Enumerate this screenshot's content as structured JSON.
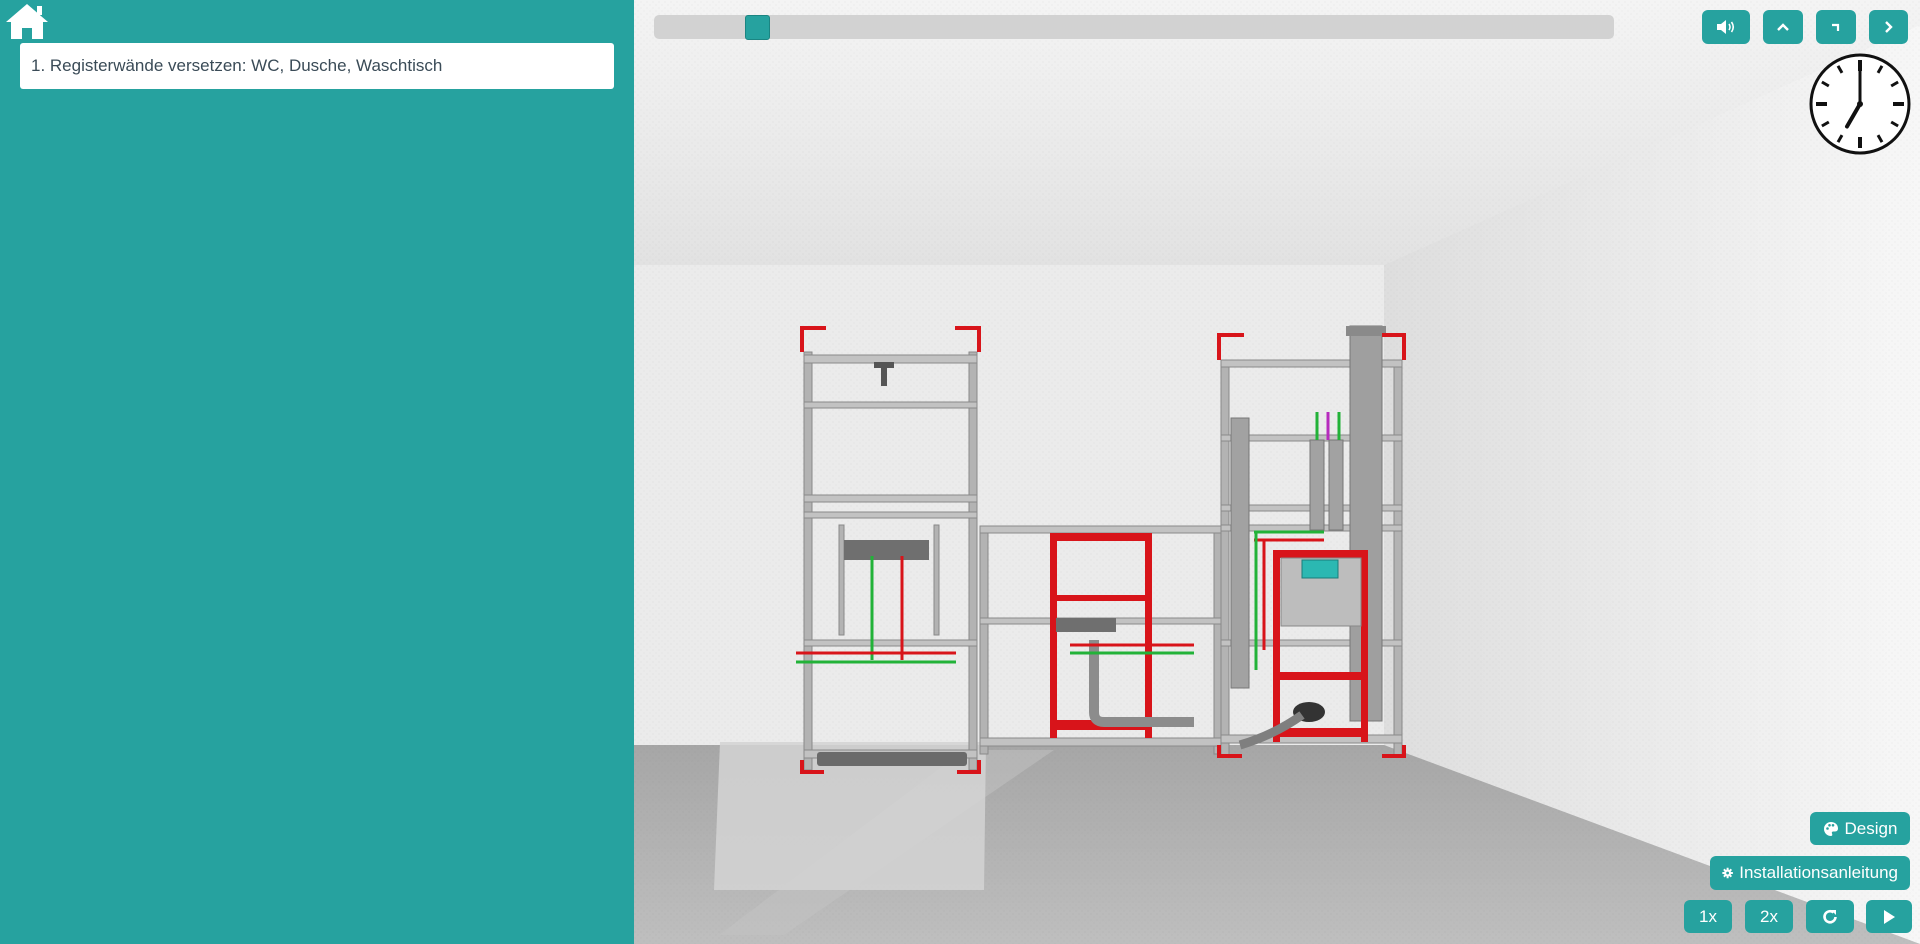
{
  "sidebar": {
    "home_icon": "home-icon",
    "step_text": "1. Registerwände versetzen: WC, Dusche, Waschtisch"
  },
  "progress": {
    "value": 0.04
  },
  "toolbar": {
    "icons": [
      "volume-icon",
      "chevron-up-icon",
      "rotate-icon",
      "chevron-right-icon"
    ]
  },
  "clock": {
    "time": "07:00"
  },
  "controls": {
    "design_label": "Design",
    "design_icon": "palette-icon",
    "install_label": "Installationsanleitung",
    "install_icon": "gear-icon",
    "speed_1x": "1x",
    "speed_2x": "2x",
    "replay_icon": "redo-icon",
    "play_icon": "play-icon"
  },
  "colors": {
    "accent": "#26a29f",
    "frame_red": "#d8141a",
    "pipe_green": "#22b238",
    "wall": "#ececec",
    "floor": "#b8b8b8"
  }
}
